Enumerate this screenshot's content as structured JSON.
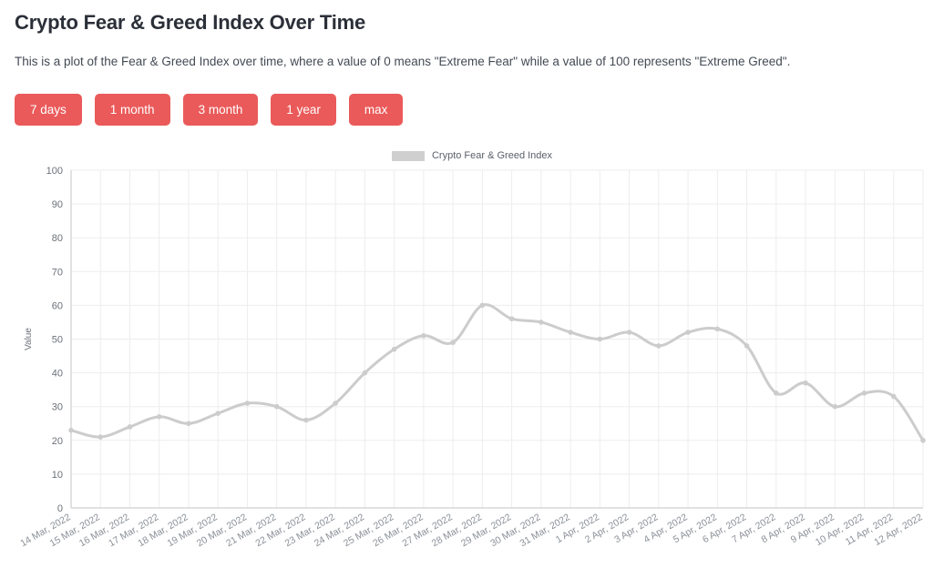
{
  "header": {
    "title": "Crypto Fear & Greed Index Over Time",
    "description": "This is a plot of the Fear & Greed Index over time, where a value of 0 means \"Extreme Fear\" while a value of 100 represents \"Extreme Greed\"."
  },
  "range_buttons": [
    {
      "label": "7 days"
    },
    {
      "label": "1 month"
    },
    {
      "label": "3 month"
    },
    {
      "label": "1 year"
    },
    {
      "label": "max"
    }
  ],
  "colors": {
    "button": "#ea5a5a",
    "button_text": "#ffffff",
    "line": "#cccccc",
    "grid": "#ededed",
    "axis": "#cfcfcf",
    "tick_text": "#6b7078"
  },
  "chart_data": {
    "type": "line",
    "title": "",
    "xlabel": "",
    "ylabel": "Value",
    "ylim": [
      0,
      100
    ],
    "y_ticks": [
      0,
      10,
      20,
      30,
      40,
      50,
      60,
      70,
      80,
      90,
      100
    ],
    "grid": true,
    "legend_position": "top-center",
    "legend": [
      "Crypto Fear & Greed Index"
    ],
    "categories": [
      "14 Mar, 2022",
      "15 Mar, 2022",
      "16 Mar, 2022",
      "17 Mar, 2022",
      "18 Mar, 2022",
      "19 Mar, 2022",
      "20 Mar, 2022",
      "21 Mar, 2022",
      "22 Mar, 2022",
      "23 Mar, 2022",
      "24 Mar, 2022",
      "25 Mar, 2022",
      "26 Mar, 2022",
      "27 Mar, 2022",
      "28 Mar, 2022",
      "29 Mar, 2022",
      "30 Mar, 2022",
      "31 Mar, 2022",
      "1 Apr, 2022",
      "2 Apr, 2022",
      "3 Apr, 2022",
      "4 Apr, 2022",
      "5 Apr, 2022",
      "6 Apr, 2022",
      "7 Apr, 2022",
      "8 Apr, 2022",
      "9 Apr, 2022",
      "10 Apr, 2022",
      "11 Apr, 2022",
      "12 Apr, 2022"
    ],
    "series": [
      {
        "name": "Crypto Fear & Greed Index",
        "color": "#cccccc",
        "values": [
          23,
          21,
          24,
          27,
          25,
          28,
          31,
          30,
          26,
          31,
          40,
          47,
          51,
          49,
          60,
          56,
          55,
          52,
          50,
          52,
          48,
          52,
          53,
          48,
          34,
          37,
          30,
          34,
          33,
          20
        ]
      }
    ]
  }
}
